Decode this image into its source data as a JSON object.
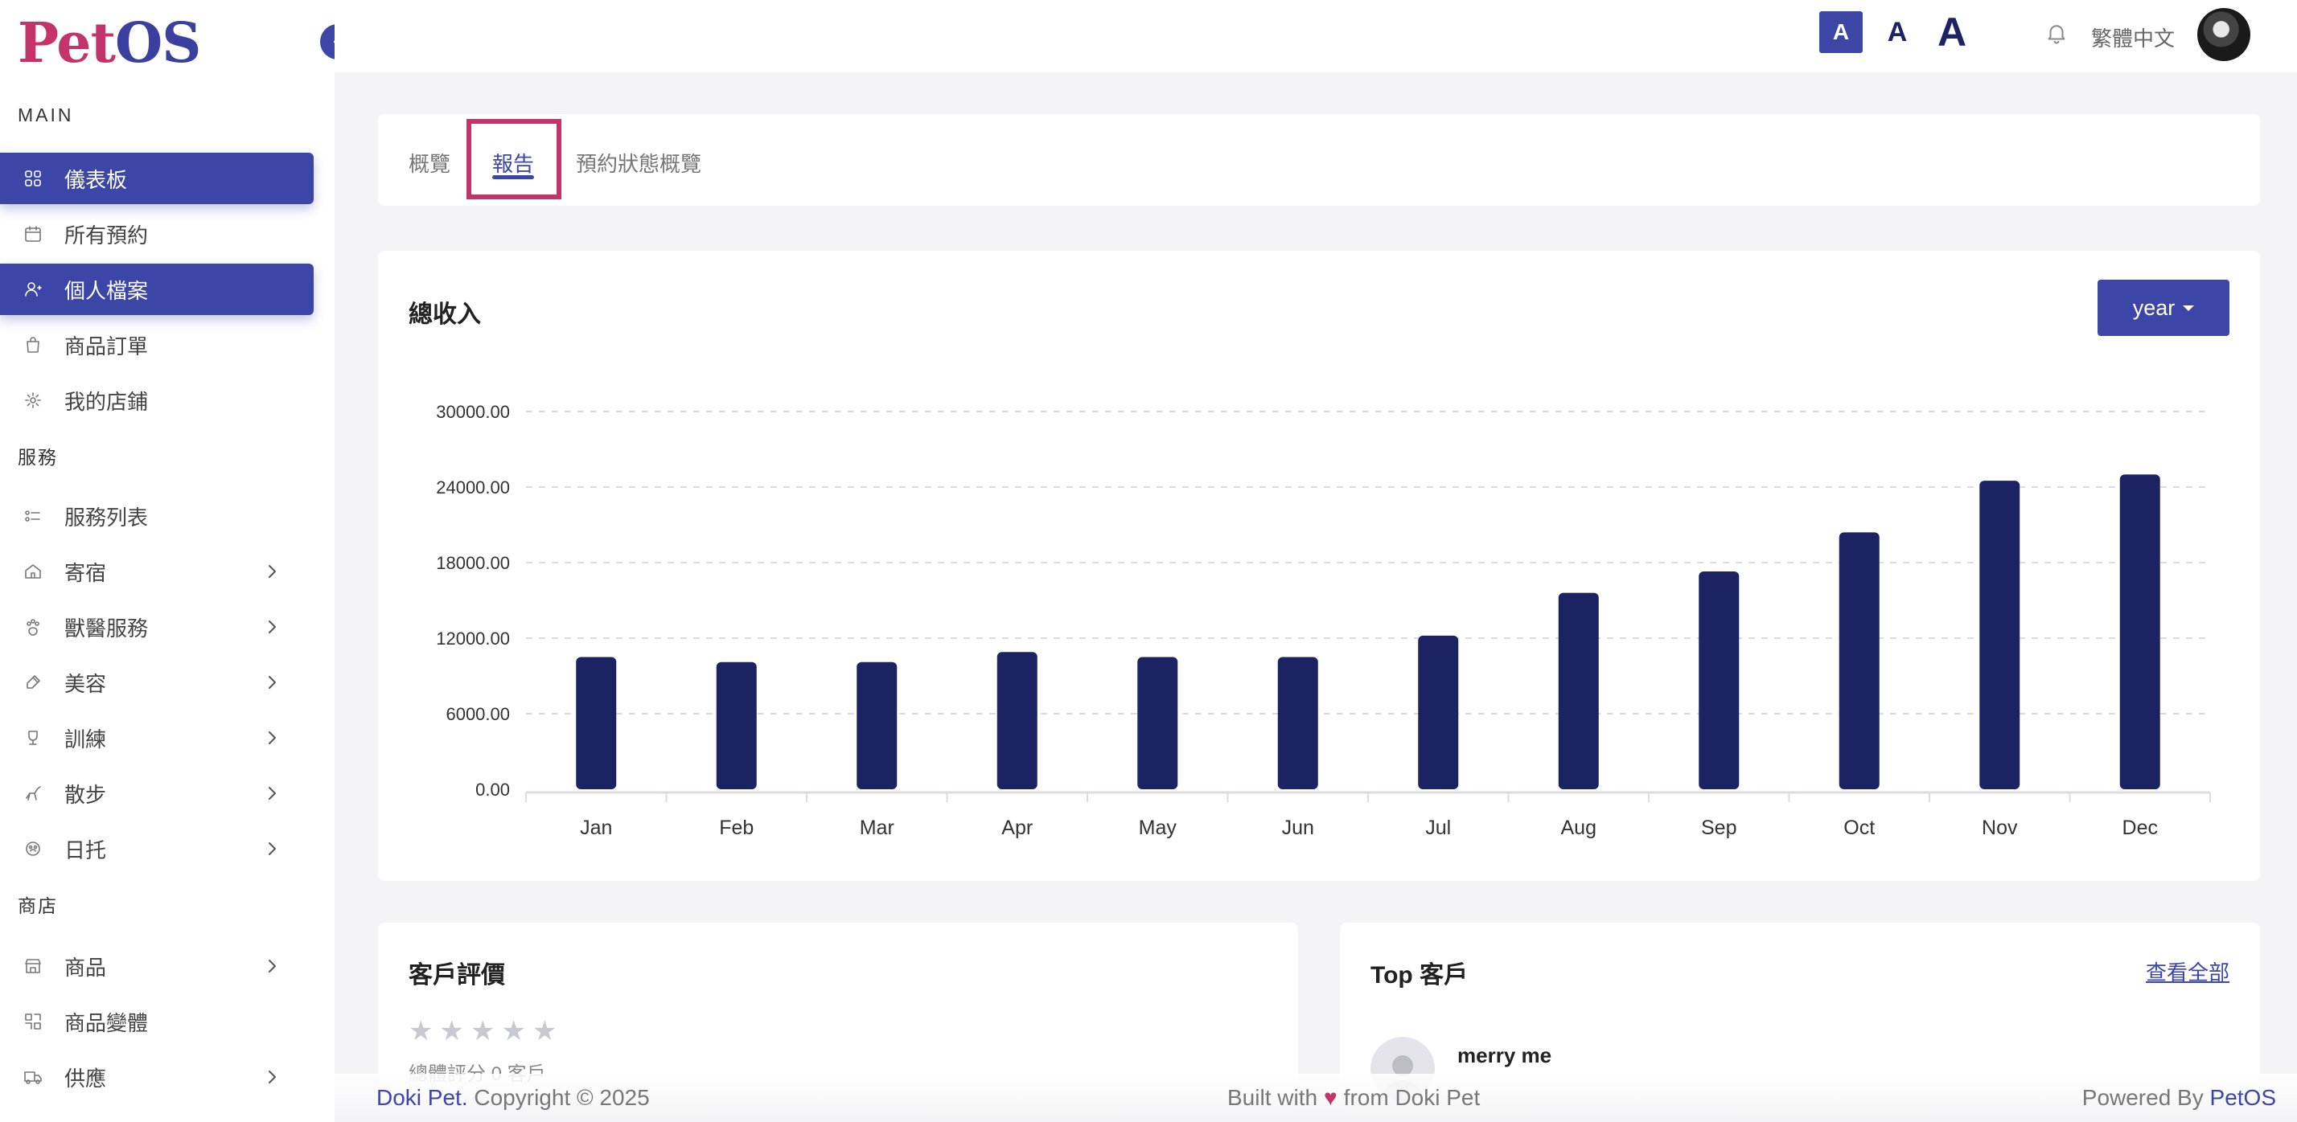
{
  "app": {
    "logo_pet": "Pet",
    "logo_os": "OS"
  },
  "sidebar": {
    "main_label": "MAIN",
    "services_label": "服務",
    "shop_label": "商店",
    "main_items": [
      {
        "label": "儀表板",
        "icon": "grid-icon",
        "active": true
      },
      {
        "label": "所有預約",
        "icon": "calendar-icon",
        "active": false
      },
      {
        "label": "個人檔案",
        "icon": "user-icon",
        "active": true
      },
      {
        "label": "商品訂單",
        "icon": "shopping-bag-icon",
        "active": false
      },
      {
        "label": "我的店鋪",
        "icon": "store-gear-icon",
        "active": false
      }
    ],
    "service_items": [
      {
        "label": "服務列表",
        "icon": "list-icon",
        "chevron": false
      },
      {
        "label": "寄宿",
        "icon": "house-icon",
        "chevron": true
      },
      {
        "label": "獸醫服務",
        "icon": "paw-icon",
        "chevron": true
      },
      {
        "label": "美容",
        "icon": "brush-icon",
        "chevron": true
      },
      {
        "label": "訓練",
        "icon": "trophy-icon",
        "chevron": true
      },
      {
        "label": "散步",
        "icon": "dog-walk-icon",
        "chevron": true
      },
      {
        "label": "日托",
        "icon": "paw-gear-icon",
        "chevron": true
      }
    ],
    "shop_items": [
      {
        "label": "商品",
        "icon": "shop-icon",
        "chevron": true
      },
      {
        "label": "商品變體",
        "icon": "variants-icon",
        "chevron": false
      },
      {
        "label": "供應",
        "icon": "truck-icon",
        "chevron": true
      }
    ]
  },
  "topbar": {
    "font_small": "A",
    "font_medium": "A",
    "font_large": "A",
    "language": "繁體中文"
  },
  "tabs": [
    {
      "label": "概覽",
      "active": false
    },
    {
      "label": "報告",
      "active": true
    },
    {
      "label": "預約狀態概覽",
      "active": false
    }
  ],
  "revenue_card": {
    "title": "總收入",
    "period_button": "year"
  },
  "chart_data": {
    "type": "bar",
    "title": "總收入",
    "categories": [
      "Jan",
      "Feb",
      "Mar",
      "Apr",
      "May",
      "Jun",
      "Jul",
      "Aug",
      "Sep",
      "Oct",
      "Nov",
      "Dec"
    ],
    "values": [
      10500,
      10100,
      10100,
      10900,
      10500,
      10500,
      12200,
      15600,
      17300,
      20400,
      24500,
      25000
    ],
    "ylim": [
      0,
      30000
    ],
    "yticks": [
      "0.00",
      "6000.00",
      "12000.00",
      "18000.00",
      "24000.00",
      "30000.00"
    ],
    "ytick_values": [
      0,
      6000,
      12000,
      18000,
      24000,
      30000
    ],
    "grid": true,
    "bar_color": "#1b2363"
  },
  "reviews_card": {
    "title": "客戶評價",
    "rating_text": "總體評分 0 客戶",
    "stars": 5
  },
  "top_customers_card": {
    "title": "Top 客戶",
    "view_all": "查看全部",
    "customers": [
      {
        "name": "merry me"
      }
    ]
  },
  "footer": {
    "left_brand": "Doki Pet.",
    "left_text": " Copyright © 2025",
    "mid_before": "Built with",
    "heart": "♥",
    "mid_after": "from Doki Pet",
    "right_text": "Powered By ",
    "right_brand": "PetOS"
  }
}
